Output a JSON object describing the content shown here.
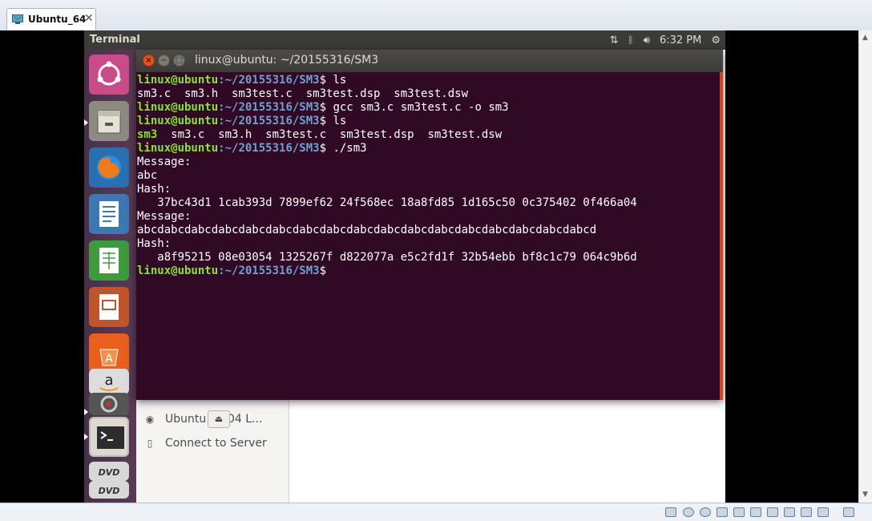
{
  "host": {
    "tab_label": "Ubuntu_64",
    "tab_close": "✕"
  },
  "panel": {
    "app_title": "Terminal",
    "time": "6:32 PM",
    "icons": [
      "network-updown-icon",
      "bluetooth-icon",
      "volume-icon",
      "settings-gear-icon"
    ]
  },
  "launcher": {
    "items": [
      "ubuntu-dash-icon",
      "files-icon",
      "firefox-icon",
      "libreoffice-writer-icon",
      "libreoffice-calc-icon",
      "libreoffice-impress-icon",
      "ubuntu-software-icon",
      "amazon-icon",
      "system-settings-icon",
      "terminal-icon",
      "dvd-icon",
      "dvd-icon"
    ]
  },
  "files": {
    "sidebar_items": [
      {
        "label": "Ubuntu 16.04 L...",
        "icon": "disc-icon"
      },
      {
        "label": "Connect to Server",
        "icon": "server-icon"
      }
    ],
    "eject_symbol": "⏏"
  },
  "terminal": {
    "title": "linux@ubuntu: ~/20155316/SM3",
    "prompt_user": "linux@ubuntu",
    "prompt_path": ":~/20155316/SM3",
    "prompt_end": "$ ",
    "lines": [
      {
        "type": "prompt",
        "cmd": "ls"
      },
      {
        "type": "out",
        "text": "sm3.c  sm3.h  sm3test.c  sm3test.dsp  sm3test.dsw"
      },
      {
        "type": "prompt",
        "cmd": "gcc sm3.c sm3test.c -o sm3"
      },
      {
        "type": "prompt",
        "cmd": "ls"
      },
      {
        "type": "ls2",
        "exec": "sm3",
        "rest": "  sm3.c  sm3.h  sm3test.c  sm3test.dsp  sm3test.dsw"
      },
      {
        "type": "prompt",
        "cmd": "./sm3"
      },
      {
        "type": "out",
        "text": "Message:"
      },
      {
        "type": "out",
        "text": "abc"
      },
      {
        "type": "out",
        "text": "Hash:"
      },
      {
        "type": "out",
        "text": "   37bc43d1 1cab393d 7899ef62 24f568ec 18a8fd85 1d165c50 0c375402 0f466a04"
      },
      {
        "type": "out",
        "text": "Message:"
      },
      {
        "type": "out",
        "text": "abcdabcdabcdabcdabcdabcdabcdabcdabcdabcdabcdabcdabcdabcdabcdabcdabcd"
      },
      {
        "type": "out",
        "text": "Hash:"
      },
      {
        "type": "out",
        "text": "   a8f95215 08e03054 1325267f d822077a e5c2fd1f 32b54ebb bf8c1c79 064c9b6d"
      },
      {
        "type": "prompt",
        "cmd": ""
      }
    ]
  },
  "colors": {
    "terminal_bg": "#300a24",
    "prompt_user": "#8ae234",
    "prompt_path": "#729fcf",
    "panel_bg": "#3c3b37",
    "close_button": "#e8501e"
  }
}
